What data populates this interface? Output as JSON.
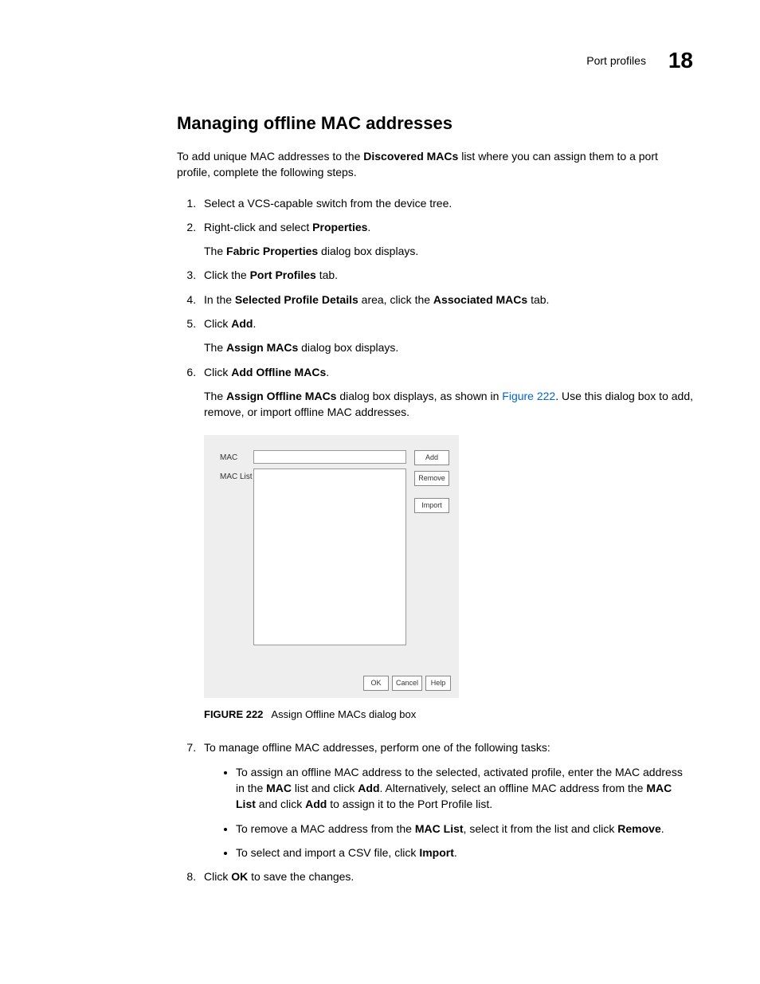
{
  "header": {
    "section_name": "Port profiles",
    "chapter_number": "18"
  },
  "heading": "Managing offline MAC addresses",
  "intro": {
    "pre": "To add unique MAC addresses to the ",
    "bold1": "Discovered MACs",
    "post": " list where you can assign them to a port profile, complete the following steps."
  },
  "steps": {
    "s1": "Select a VCS-capable switch from the device tree.",
    "s2": {
      "pre": "Right-click and select ",
      "b": "Properties",
      "post": "."
    },
    "s2sub": {
      "pre": "The ",
      "b": "Fabric Properties",
      "post": " dialog box displays."
    },
    "s3": {
      "pre": "Click the ",
      "b": "Port Profiles",
      "post": " tab."
    },
    "s4": {
      "pre": "In the ",
      "b1": "Selected Profile Details",
      "mid": " area, click the ",
      "b2": "Associated MACs",
      "post": " tab."
    },
    "s5": {
      "pre": "Click ",
      "b": "Add",
      "post": "."
    },
    "s5sub": {
      "pre": "The ",
      "b": "Assign MACs",
      "post": " dialog box displays."
    },
    "s6": {
      "pre": "Click ",
      "b": "Add Offline MACs",
      "post": "."
    },
    "s6sub": {
      "pre": "The ",
      "b": "Assign Offline MACs",
      "mid": " dialog box displays, as shown in ",
      "link": "Figure 222",
      "post": ". Use this dialog box to add, remove, or import offline MAC addresses."
    },
    "s7": "To manage offline MAC addresses, perform one of the following tasks:",
    "s7bullets": {
      "b1": {
        "t1": "To assign an offline MAC address to the selected, activated profile, enter the MAC address in the ",
        "b1": "MAC",
        "t2": " list and click ",
        "b2": "Add",
        "t3": ". Alternatively, select an offline MAC address from the ",
        "b3": "MAC List",
        "t4": " and click ",
        "b4": "Add",
        "t5": " to assign it to the Port Profile list."
      },
      "b2": {
        "t1": "To remove a MAC address from the ",
        "b1": "MAC List",
        "t2": ", select it from the list and click ",
        "b2": "Remove",
        "t3": "."
      },
      "b3": {
        "t1": "To select and import a CSV file, click ",
        "b1": "Import",
        "t2": "."
      }
    },
    "s8": {
      "pre": "Click ",
      "b": "OK",
      "post": " to save the changes."
    }
  },
  "dialog": {
    "label_mac": "MAC",
    "label_list": "MAC List",
    "btn_add": "Add",
    "btn_remove": "Remove",
    "btn_import": "Import",
    "btn_ok": "OK",
    "btn_cancel": "Cancel",
    "btn_help": "Help"
  },
  "figure": {
    "num": "FIGURE 222",
    "caption": "Assign Offline MACs dialog box"
  }
}
